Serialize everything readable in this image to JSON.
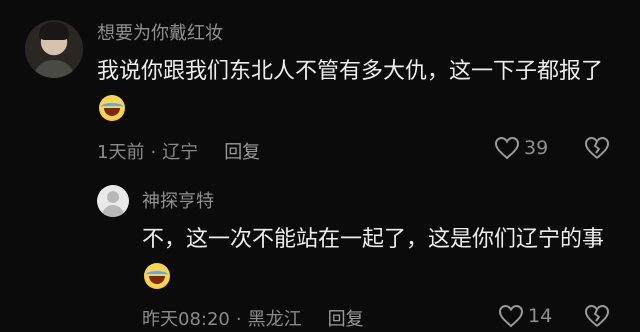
{
  "comments": [
    {
      "username": "想要为你戴红妆",
      "text": "我说你跟我们东北人不管有多大仇，这一下子都报了",
      "time": "1天前",
      "location": "辽宁",
      "reply_label": "回复",
      "likes": "39",
      "emoji": "crying-laughing-emoji"
    },
    {
      "username": "神探亨特",
      "text": "不，这一次不能站在一起了，这是你们辽宁的事",
      "time": "昨天08:20",
      "location": "黑龙江",
      "reply_label": "回复",
      "likes": "14",
      "emoji": "crying-laughing-emoji"
    }
  ],
  "separator": "·"
}
